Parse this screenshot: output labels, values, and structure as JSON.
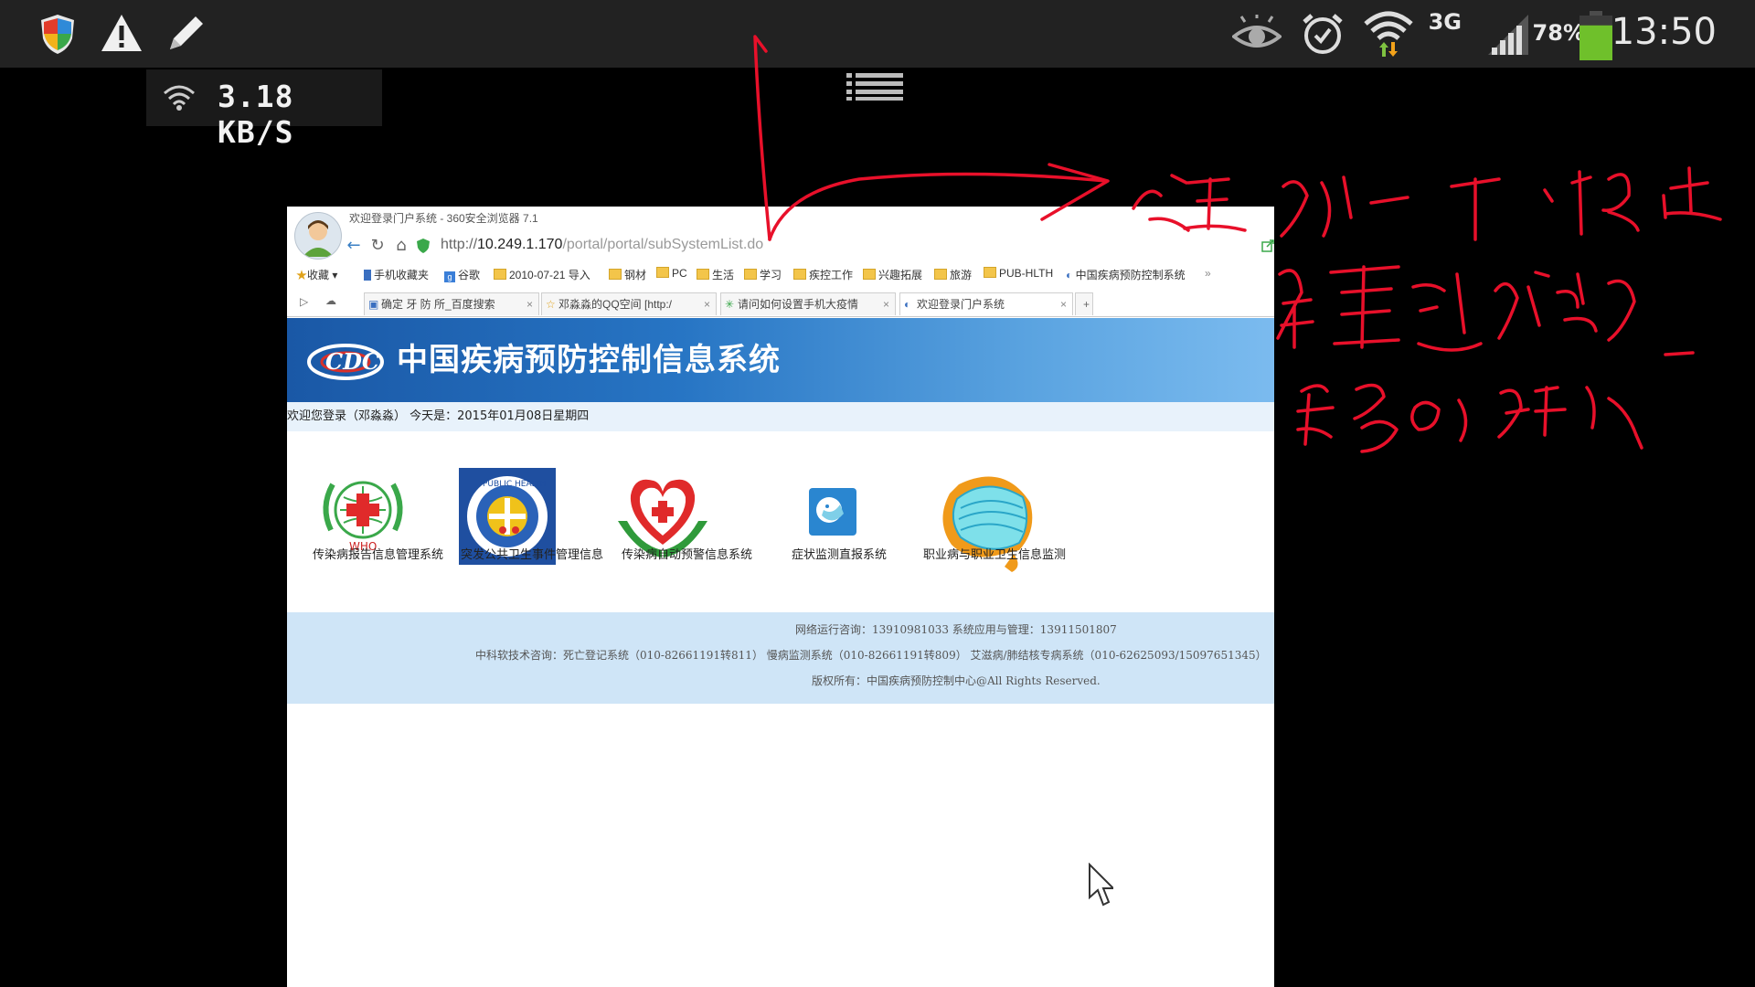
{
  "status_bar": {
    "icons_left": [
      "shield-icon",
      "warning-icon",
      "pencil-icon"
    ],
    "icons_right": [
      "eye-icon",
      "alarm-icon",
      "wifi-icon",
      "signal-icon",
      "battery-icon"
    ],
    "network_type": "3G",
    "battery": "78%",
    "battery_level": 0.78,
    "time": "13:50"
  },
  "net_speed": "3.18 KB/S",
  "browser": {
    "title": "欢迎登录门户系统 - 360安全浏览器 7.1",
    "address": {
      "scheme": "http://",
      "host": "10.249.1.170",
      "path": "/portal/portal/subSystemList.do"
    },
    "bookmarks": [
      "收藏",
      "手机收藏夹",
      "谷歌",
      "2010-07-21 导入",
      "钢材",
      "PC",
      "生活",
      "学习",
      "疾控工作",
      "兴趣拓展",
      "旅游",
      "PUB-HLTH",
      "中国疾病预防控制系统"
    ],
    "tabs": [
      {
        "label": "确定 牙 防 所_百度搜索"
      },
      {
        "label": "邓淼淼的QQ空间 [http:/"
      },
      {
        "label": "请问如何设置手机大疫情"
      },
      {
        "label": "欢迎登录门户系统"
      }
    ],
    "new_tab": "+"
  },
  "page": {
    "title": "中国疾病预防控制信息系统",
    "welcome": "欢迎您登录（邓淼淼） 今天是：2015年01月08日星期四",
    "systems": [
      {
        "label": "传染病报告信息管理系统",
        "icon": "red-cross-emblem-icon"
      },
      {
        "label": "突发公共卫生事件管理信息",
        "icon": "public-health-badge-icon"
      },
      {
        "label": "传染病自动预警信息系统",
        "icon": "heart-hands-icon"
      },
      {
        "label": "症状监测直报系统",
        "icon": "face-mask-small-icon"
      },
      {
        "label": "职业病与职业卫生信息监测",
        "icon": "face-mask-large-icon"
      }
    ],
    "footer": {
      "line1": "网络运行咨询：13910981033  系统应用与管理：13911501807",
      "line2": "中科软技术咨询：死亡登记系统（010-82661191转811）  慢病监测系统（010-82661191转809）  艾滋病/肺结核专病系统（010-62625093/15097651345）",
      "line3": "版权所有：中国疾病预防控制中心@All Rights Reserved."
    }
  },
  "annotation": {
    "text_lines": [
      "这里刷新一下，按出",
      "键盘进入帐号、",
      "密码的输入，"
    ],
    "color": "#e8102a"
  },
  "colors": {
    "banner": "#2470bd",
    "footer_bg": "#cfe5f7",
    "status_bar": "#222222"
  }
}
